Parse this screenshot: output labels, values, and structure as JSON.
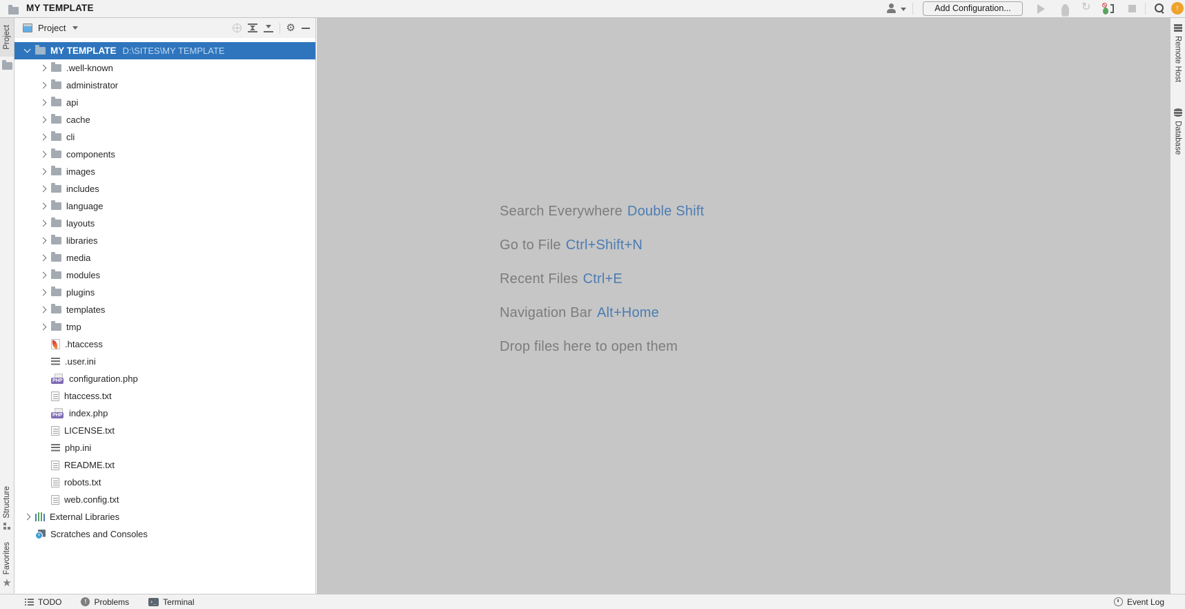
{
  "colors": {
    "selection_blue": "#2E75BD",
    "editor_background": "#C6C6C6",
    "bar_background": "#F2F2F2",
    "hint_text": "#7C7C7C",
    "hint_shortcut_blue": "#4B7CB3",
    "update_badge_orange": "#EEA32C",
    "php_badge_purple": "#7E6BB5"
  },
  "title_bar": {
    "project_name": "MY TEMPLATE",
    "add_configuration_label": "Add Configuration...",
    "update_arrow": "↑",
    "rerun_glyph": "↻"
  },
  "left_toolbar": {
    "project_label": "Project",
    "structure_label": "Structure",
    "favorites_label": "Favorites",
    "star_glyph": "★"
  },
  "right_toolbar": {
    "remote_host_label": "Remote Host",
    "database_label": "Database"
  },
  "project_panel": {
    "header": {
      "title": "Project",
      "gear_glyph": "⚙"
    },
    "tree": {
      "root": {
        "name": "MY TEMPLATE",
        "path": "D:\\SITES\\MY TEMPLATE"
      },
      "folders": [
        ".well-known",
        "administrator",
        "api",
        "cache",
        "cli",
        "components",
        "images",
        "includes",
        "language",
        "layouts",
        "libraries",
        "media",
        "modules",
        "plugins",
        "templates",
        "tmp"
      ],
      "files": [
        {
          "name": ".htaccess",
          "icon": "apache"
        },
        {
          "name": ".user.ini",
          "icon": "ini"
        },
        {
          "name": "configuration.php",
          "icon": "php"
        },
        {
          "name": "htaccess.txt",
          "icon": "text"
        },
        {
          "name": "index.php",
          "icon": "php"
        },
        {
          "name": "LICENSE.txt",
          "icon": "text"
        },
        {
          "name": "php.ini",
          "icon": "ini"
        },
        {
          "name": "README.txt",
          "icon": "text"
        },
        {
          "name": "robots.txt",
          "icon": "text"
        },
        {
          "name": "web.config.txt",
          "icon": "text"
        }
      ],
      "special": [
        {
          "name": "External Libraries",
          "icon": "extlib",
          "chevron": true
        },
        {
          "name": "Scratches and Consoles",
          "icon": "scratches",
          "chevron": false
        }
      ]
    }
  },
  "editor_hints": [
    {
      "label": "Search Everywhere",
      "shortcut": "Double Shift"
    },
    {
      "label": "Go to File",
      "shortcut": "Ctrl+Shift+N"
    },
    {
      "label": "Recent Files",
      "shortcut": "Ctrl+E"
    },
    {
      "label": "Navigation Bar",
      "shortcut": "Alt+Home"
    },
    {
      "label": "Drop files here to open them",
      "shortcut": ""
    }
  ],
  "status_bar": {
    "left_items": [
      {
        "label": "TODO",
        "icon": "todo"
      },
      {
        "label": "Problems",
        "icon": "problems"
      },
      {
        "label": "Terminal",
        "icon": "terminal"
      }
    ],
    "event_log_label": "Event Log",
    "problems_glyph": "!",
    "terminal_glyph": "›_"
  }
}
